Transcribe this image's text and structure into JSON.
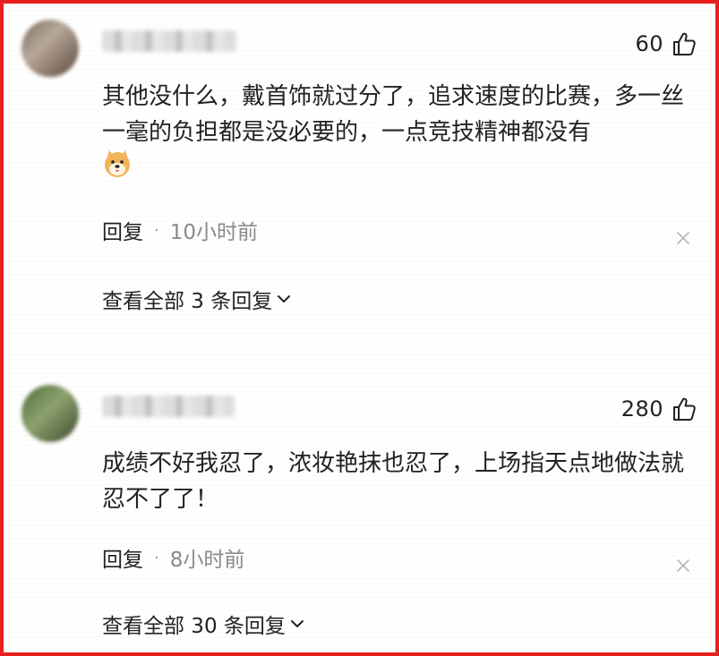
{
  "comments": [
    {
      "likes": "60",
      "text": "其他没什么，戴首饰就过分了，追求速度的比赛，多一丝一毫的负担都是没必要的，一点竞技精神都没有",
      "reply_label": "回复",
      "separator": "·",
      "time": "10小时前",
      "view_replies": "查看全部 3 条回复"
    },
    {
      "likes": "280",
      "text": "成绩不好我忍了，浓妆艳抹也忍了，上场指天点地做法就忍不了了！",
      "reply_label": "回复",
      "separator": "·",
      "time": "8小时前",
      "view_replies": "查看全部 30 条回复"
    }
  ],
  "icons": {
    "like": "thumbs-up-icon",
    "emoji": "doge-emoji-icon",
    "close": "close-icon",
    "expand": "chevron-down-icon"
  },
  "colors": {
    "border": "#e8211c",
    "text": "#222222",
    "secondary_text": "#8a8a8a"
  }
}
